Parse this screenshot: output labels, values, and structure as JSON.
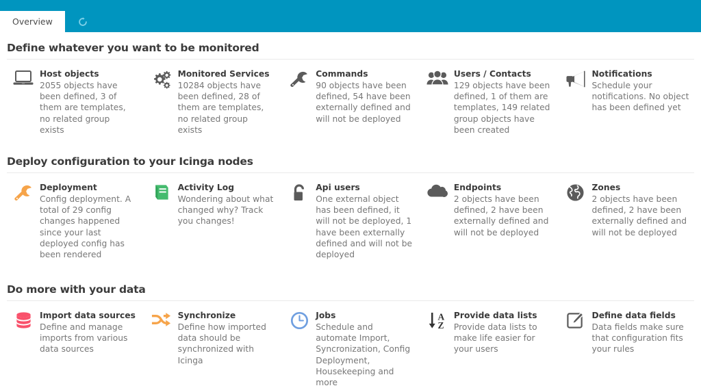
{
  "tabs": {
    "overview_label": "Overview",
    "refresh_icon": "refresh-icon"
  },
  "theme": {
    "accent": "#0095bf",
    "title_color": "#3b3b3b",
    "text_color": "#777777",
    "grey_icon": "#5b5b5b",
    "orange_icon": "#f6a44a",
    "green_icon": "#44bb6e",
    "red_icon": "#f9516b",
    "blue_icon": "#6f9fe0"
  },
  "sections": [
    {
      "id": "monitored",
      "title": "Define whatever you want to be monitored",
      "items": [
        {
          "icon": "laptop-icon",
          "title": "Host objects",
          "desc": "2055 objects have been defined, 3 of them are templates, no related group exists"
        },
        {
          "icon": "gears-icon",
          "title": "Monitored Services",
          "desc": "10284 objects have been defined, 28 of them are templates, no related group exists"
        },
        {
          "icon": "wrench-icon",
          "title": "Commands",
          "desc": "90 objects have been defined, 54 have been externally defined and will not be deployed"
        },
        {
          "icon": "users-icon",
          "title": "Users / Contacts",
          "desc": "129 objects have been defined, 1 of them are templates, 149 related group objects have been created"
        },
        {
          "icon": "megaphone-icon",
          "title": "Notifications",
          "desc": "Schedule your notifications. No object has been defined yet"
        }
      ]
    },
    {
      "id": "deploy",
      "title": "Deploy configuration to your Icinga nodes",
      "items": [
        {
          "icon": "wrench-orange-icon",
          "title": "Deployment",
          "desc": "Config deployment. A total of 29 config changes happened since your last deployed config has been rendered"
        },
        {
          "icon": "book-icon",
          "title": "Activity Log",
          "desc": "Wondering about what changed why? Track you changes!"
        },
        {
          "icon": "unlock-icon",
          "title": "Api users",
          "desc": "One external object has been defined, it will not be deployed, 1 have been externally defined and will not be deployed"
        },
        {
          "icon": "cloud-icon",
          "title": "Endpoints",
          "desc": "2 objects have been defined, 2 have been externally defined and will not be deployed"
        },
        {
          "icon": "globe-icon",
          "title": "Zones",
          "desc": "2 objects have been defined, 2 have been externally defined and will not be deployed"
        }
      ]
    },
    {
      "id": "data",
      "title": "Do more with your data",
      "items": [
        {
          "icon": "database-icon",
          "title": "Import data sources",
          "desc": "Define and manage imports from various data sources"
        },
        {
          "icon": "shuffle-icon",
          "title": "Synchronize",
          "desc": "Define how imported data should be synchronized with Icinga"
        },
        {
          "icon": "clock-icon",
          "title": "Jobs",
          "desc": "Schedule and automate Import, Syncronization, Config Deployment, Housekeeping and more"
        },
        {
          "icon": "sort-az-icon",
          "title": "Provide data lists",
          "desc": "Provide data lists to make life easier for your users"
        },
        {
          "icon": "edit-square-icon",
          "title": "Define data fields",
          "desc": "Data fields make sure that configuration fits your rules"
        }
      ]
    }
  ]
}
